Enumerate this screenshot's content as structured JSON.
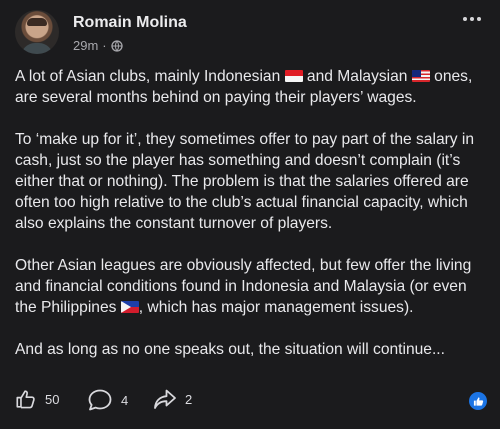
{
  "author": {
    "name": "Romain Molina",
    "time": "29m",
    "privacy_icon": "globe-icon"
  },
  "post": {
    "paragraphs": [
      {
        "segments": [
          "A lot of Asian clubs, mainly Indonesian ",
          " and Malaysian ",
          " ones, are several months behind on paying their players’ wages."
        ]
      },
      {
        "text": "To ‘make up for it’, they sometimes offer to pay part of the salary in cash, just so the player has something and doesn’t complain (it’s either that or nothing). The problem is that the salaries offered are often too high relative to the club’s actual financial capacity, which also explains the constant turnover of players."
      },
      {
        "segments": [
          "Other Asian leagues are obviously affected, but few offer the living and financial conditions found in Indonesia and Malaysia (or even the Philippines ",
          ", which has major management issues)."
        ]
      },
      {
        "text": "And as long as no one speaks out, the situation will continue..."
      }
    ],
    "flags": [
      "indonesia-flag-icon",
      "malaysia-flag-icon",
      "philippines-flag-icon"
    ]
  },
  "actions": {
    "likes": "50",
    "comments": "4",
    "shares": "2"
  },
  "colors": {
    "background": "#1b1b1d",
    "text": "#e9e9ec",
    "like_badge": "#1b74e4"
  }
}
